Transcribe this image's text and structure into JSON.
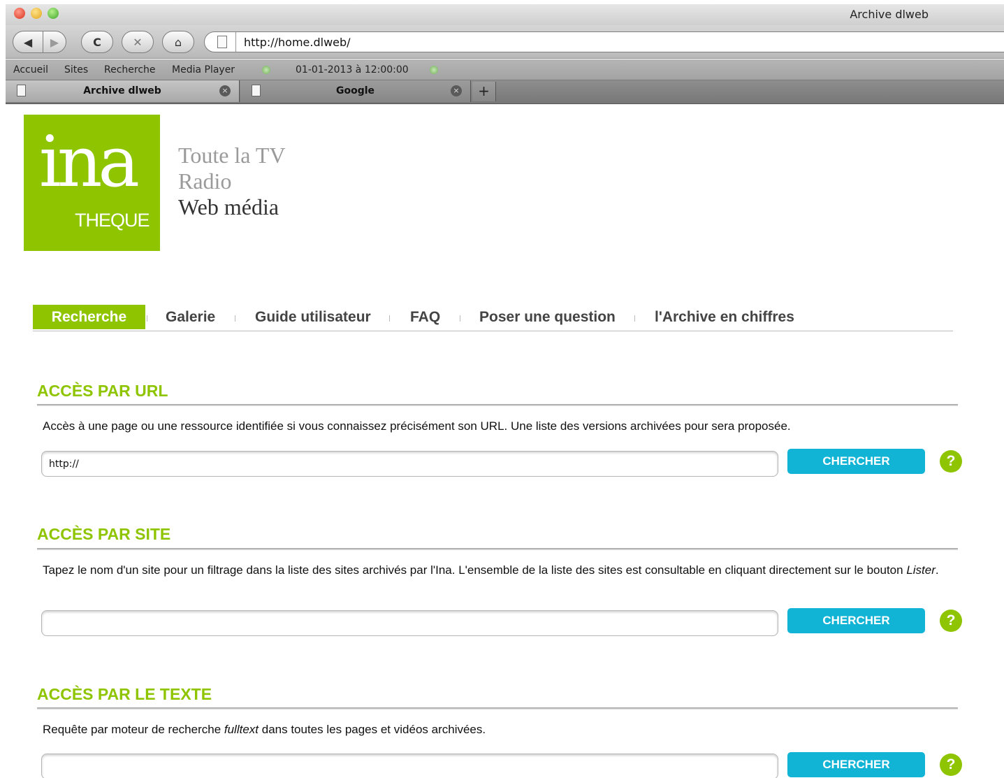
{
  "window": {
    "title": "Archive dlweb"
  },
  "toolbar": {
    "url": "http://home.dlweb/",
    "back_icon": "◀",
    "forward_icon": "▶",
    "reload_icon": "C",
    "stop_icon": "✕",
    "home_icon": "⌂"
  },
  "bookmarks": {
    "items": [
      "Accueil",
      "Sites",
      "Recherche",
      "Media Player"
    ],
    "date": "01-01-2013 à 12:00:00"
  },
  "tabs": [
    {
      "title": "Archive dlweb",
      "active": true
    },
    {
      "title": "Google",
      "active": false
    }
  ],
  "newtab_label": "+",
  "tab_close_glyph": "×",
  "logo": {
    "main": "ina",
    "sub": "THEQUE",
    "color": "#8ec400"
  },
  "tagline": [
    "Toute la TV",
    "Radio",
    "Web média"
  ],
  "menu": [
    "Recherche",
    "Galerie",
    "Guide utilisateur",
    "FAQ",
    "Poser une question",
    "l'Archive en chiffres"
  ],
  "sections": {
    "url": {
      "title": "ACCÈS PAR URL",
      "description": "Accès à une page ou une ressource identifiée si vous connaissez précisément son URL. Une liste des versions archivées pour sera proposée.",
      "input_value": "http://",
      "button": "CHERCHER"
    },
    "site": {
      "title": "ACCÈS PAR SITE",
      "description_main": "Tapez le nom d'un site pour un filtrage dans la liste des sites archivés par l'Ina. L'ensemble de la liste des sites est consultable en cliquant directement sur le bouton ",
      "description_em": "Lister",
      "description_end": ".",
      "input_value": "",
      "button": "CHERCHER"
    },
    "text": {
      "title": "ACCÈS PAR LE TEXTE",
      "description_pre": "Requête par moteur de recherche ",
      "description_em": "fulltext",
      "description_post": " dans toutes les pages et vidéos archivées.",
      "input_value": "",
      "button": "CHERCHER"
    }
  },
  "help_glyph": "?",
  "colors": {
    "accent": "#8ec400",
    "button": "#12b4d6"
  }
}
